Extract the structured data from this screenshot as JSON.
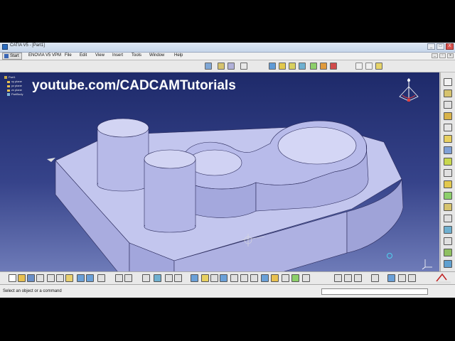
{
  "window": {
    "title": "CATIA V5 - [Part1]",
    "minimize": "_",
    "maximize": "□",
    "close": "X"
  },
  "menu": {
    "items": [
      "Start",
      "ENOVIA V5 VPM",
      "File",
      "Edit",
      "View",
      "Insert",
      "Tools",
      "Window",
      "Help"
    ]
  },
  "doc_buttons": {
    "minimize": "_",
    "restore": "▫",
    "close": "x"
  },
  "watermark": {
    "text": "youtube.com/CADCAMTutorials"
  },
  "tree": {
    "root": "Part1",
    "items": [
      "xy plane",
      "yz plane",
      "zx plane",
      "PartBody"
    ]
  },
  "status": {
    "message": "Select an object or a command"
  },
  "colors": {
    "accent": "#2a6cc0",
    "part_face_top": "#c9cbef",
    "part_face_side": "#9ea2d6",
    "background_top": "#1e2a6a"
  },
  "icons": {
    "top_toolbar": [
      "sketch-icon",
      "pad-icon",
      "pocket-icon",
      "shaft-icon",
      "hole-icon",
      "fillet-icon",
      "chamfer-icon",
      "draft-icon",
      "point-icon",
      "line-icon",
      "plane-icon"
    ],
    "compass": "compass-icon",
    "axis": "axis-triad-icon",
    "logo": "catia-logo-icon"
  }
}
